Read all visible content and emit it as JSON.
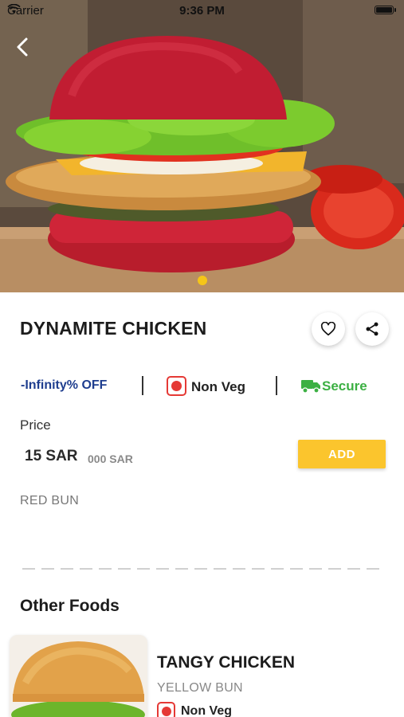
{
  "status_bar": {
    "carrier": "Carrier",
    "time": "9:36 PM"
  },
  "hero": {
    "image": "red bun chicken burger photo",
    "carousel_dots": 1,
    "active_dot": 0
  },
  "product": {
    "title": "DYNAMITE CHICKEN",
    "discount": "-Infinity% OFF",
    "veg_label": "Non Veg",
    "secure_label": "Secure",
    "price_label": "Price",
    "price": "15 SAR",
    "old_price": "000 SAR",
    "add_label": "ADD",
    "bun": "RED BUN"
  },
  "other_foods": {
    "heading": "Other Foods",
    "items": [
      {
        "title": "TANGY CHICKEN",
        "bun": "YELLOW BUN",
        "veg_label": "Non Veg"
      }
    ]
  },
  "colors": {
    "accent": "#fbc52d",
    "discount": "#1f3e8f",
    "secure": "#3cb043",
    "non_veg": "#e53935"
  },
  "icons": [
    "back-arrow-icon",
    "heart-icon",
    "share-icon",
    "truck-icon",
    "wifi-icon",
    "battery-icon",
    "non-veg-icon"
  ]
}
